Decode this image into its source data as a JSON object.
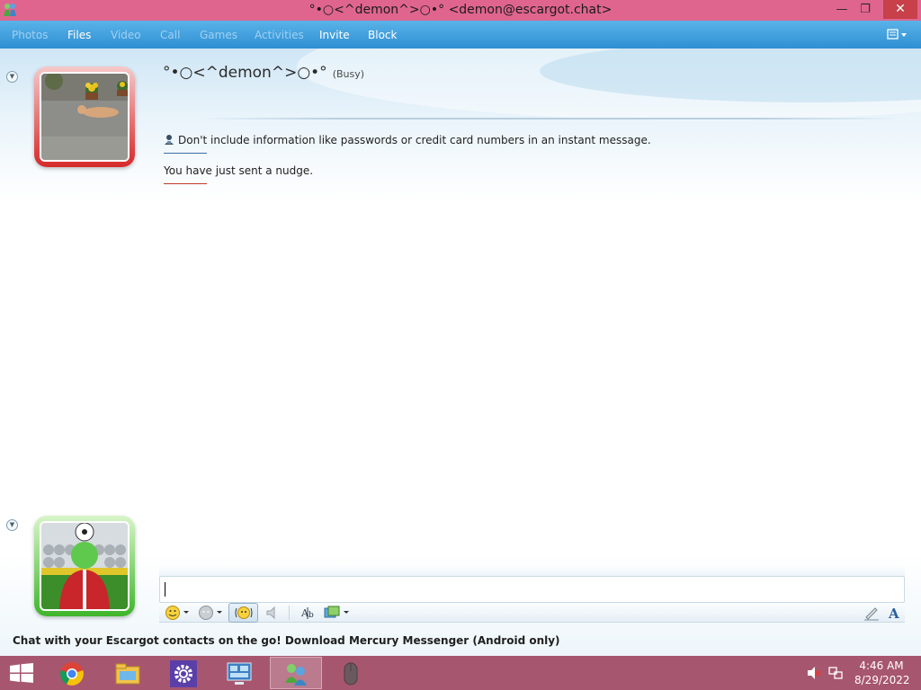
{
  "window": {
    "title": "°•○<^demon^>○•° <demon@escargot.chat>",
    "min_glyph": "—",
    "max_glyph": "❐",
    "close_glyph": "✕"
  },
  "menu": {
    "items": [
      {
        "label": "Photos",
        "enabled": false
      },
      {
        "label": "Files",
        "enabled": true
      },
      {
        "label": "Video",
        "enabled": false
      },
      {
        "label": "Call",
        "enabled": false
      },
      {
        "label": "Games",
        "enabled": false
      },
      {
        "label": "Activities",
        "enabled": false
      },
      {
        "label": "Invite",
        "enabled": true
      },
      {
        "label": "Block",
        "enabled": true
      }
    ],
    "layout_icon": "layout-options-icon"
  },
  "contact": {
    "name": "°•○<^demon^>○•°",
    "status": "(Busy)",
    "status_color": "#d62a2a"
  },
  "messages": {
    "warning": "Don't include information like passwords or credit card numbers in an instant message.",
    "nudge": "You have just sent a nudge."
  },
  "compose": {
    "value": ""
  },
  "toolbar": {
    "icons": [
      "emoticon-icon",
      "wink-icon",
      "nudge-icon",
      "voice-clip-icon",
      "font-icon",
      "background-icon",
      "handwriting-icon",
      "text-format-icon"
    ]
  },
  "promo": {
    "text": "Chat with your Escargot contacts on the go! Download Mercury Messenger (Android only)"
  },
  "self": {
    "status_color": "#3fb62a"
  },
  "taskbar": {
    "time": "4:46 AM",
    "date": "8/29/2022",
    "apps": [
      "chrome-icon",
      "file-explorer-icon",
      "settings-icon",
      "control-panel-icon",
      "messenger-icon",
      "mouse-icon"
    ],
    "color": "#a7566f"
  }
}
